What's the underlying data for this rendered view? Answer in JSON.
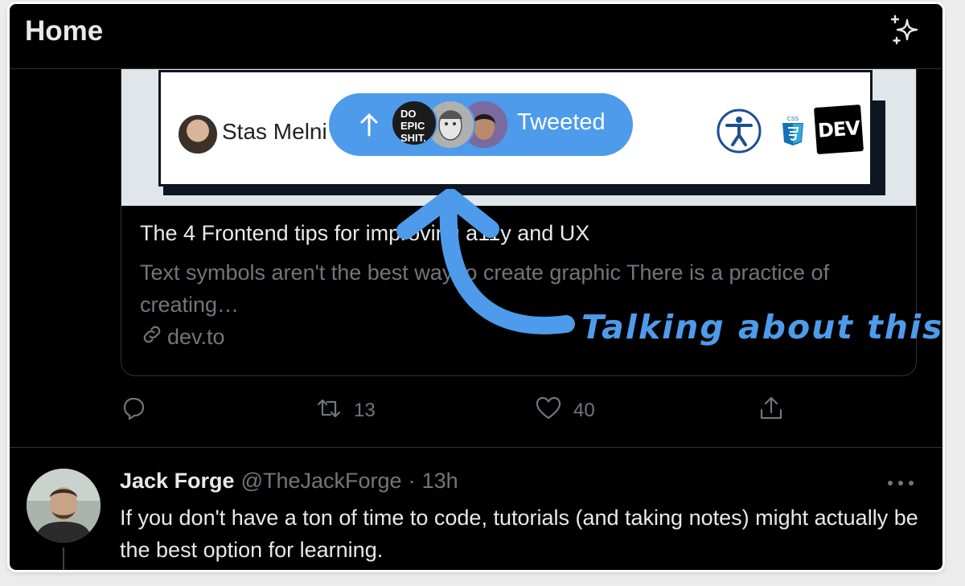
{
  "header": {
    "title": "Home",
    "icon": "sparkle-icon"
  },
  "card": {
    "image": {
      "author_name": "Stas Melnikov",
      "logos": [
        "accessibility-icon",
        "css3-icon",
        "dev-logo"
      ],
      "dev_label": "DEV",
      "css_label": "CSS"
    },
    "title": "The 4 Frontend tips for improving a11y and UX",
    "description": "Text symbols aren't the best way to create graphic There is a practice of creating…",
    "link": "dev.to"
  },
  "actions": {
    "reply_count": "",
    "retweet_count": "13",
    "like_count": "40"
  },
  "tweet2": {
    "name": "Jack Forge",
    "handle": "@TheJackForge",
    "dot": "·",
    "time": "13h",
    "text": "If you don't have a ton of time to code, tutorials (and taking notes) might actually be the best option for learning."
  },
  "tweeted_pill": {
    "label": "Tweeted",
    "avatar1_text": "DO EPIC SHIT."
  },
  "annotation": {
    "text": "Talking about this"
  },
  "colors": {
    "accent": "#4d9bea",
    "background": "#000000",
    "muted": "#71767b",
    "text": "#e7e9ea"
  }
}
